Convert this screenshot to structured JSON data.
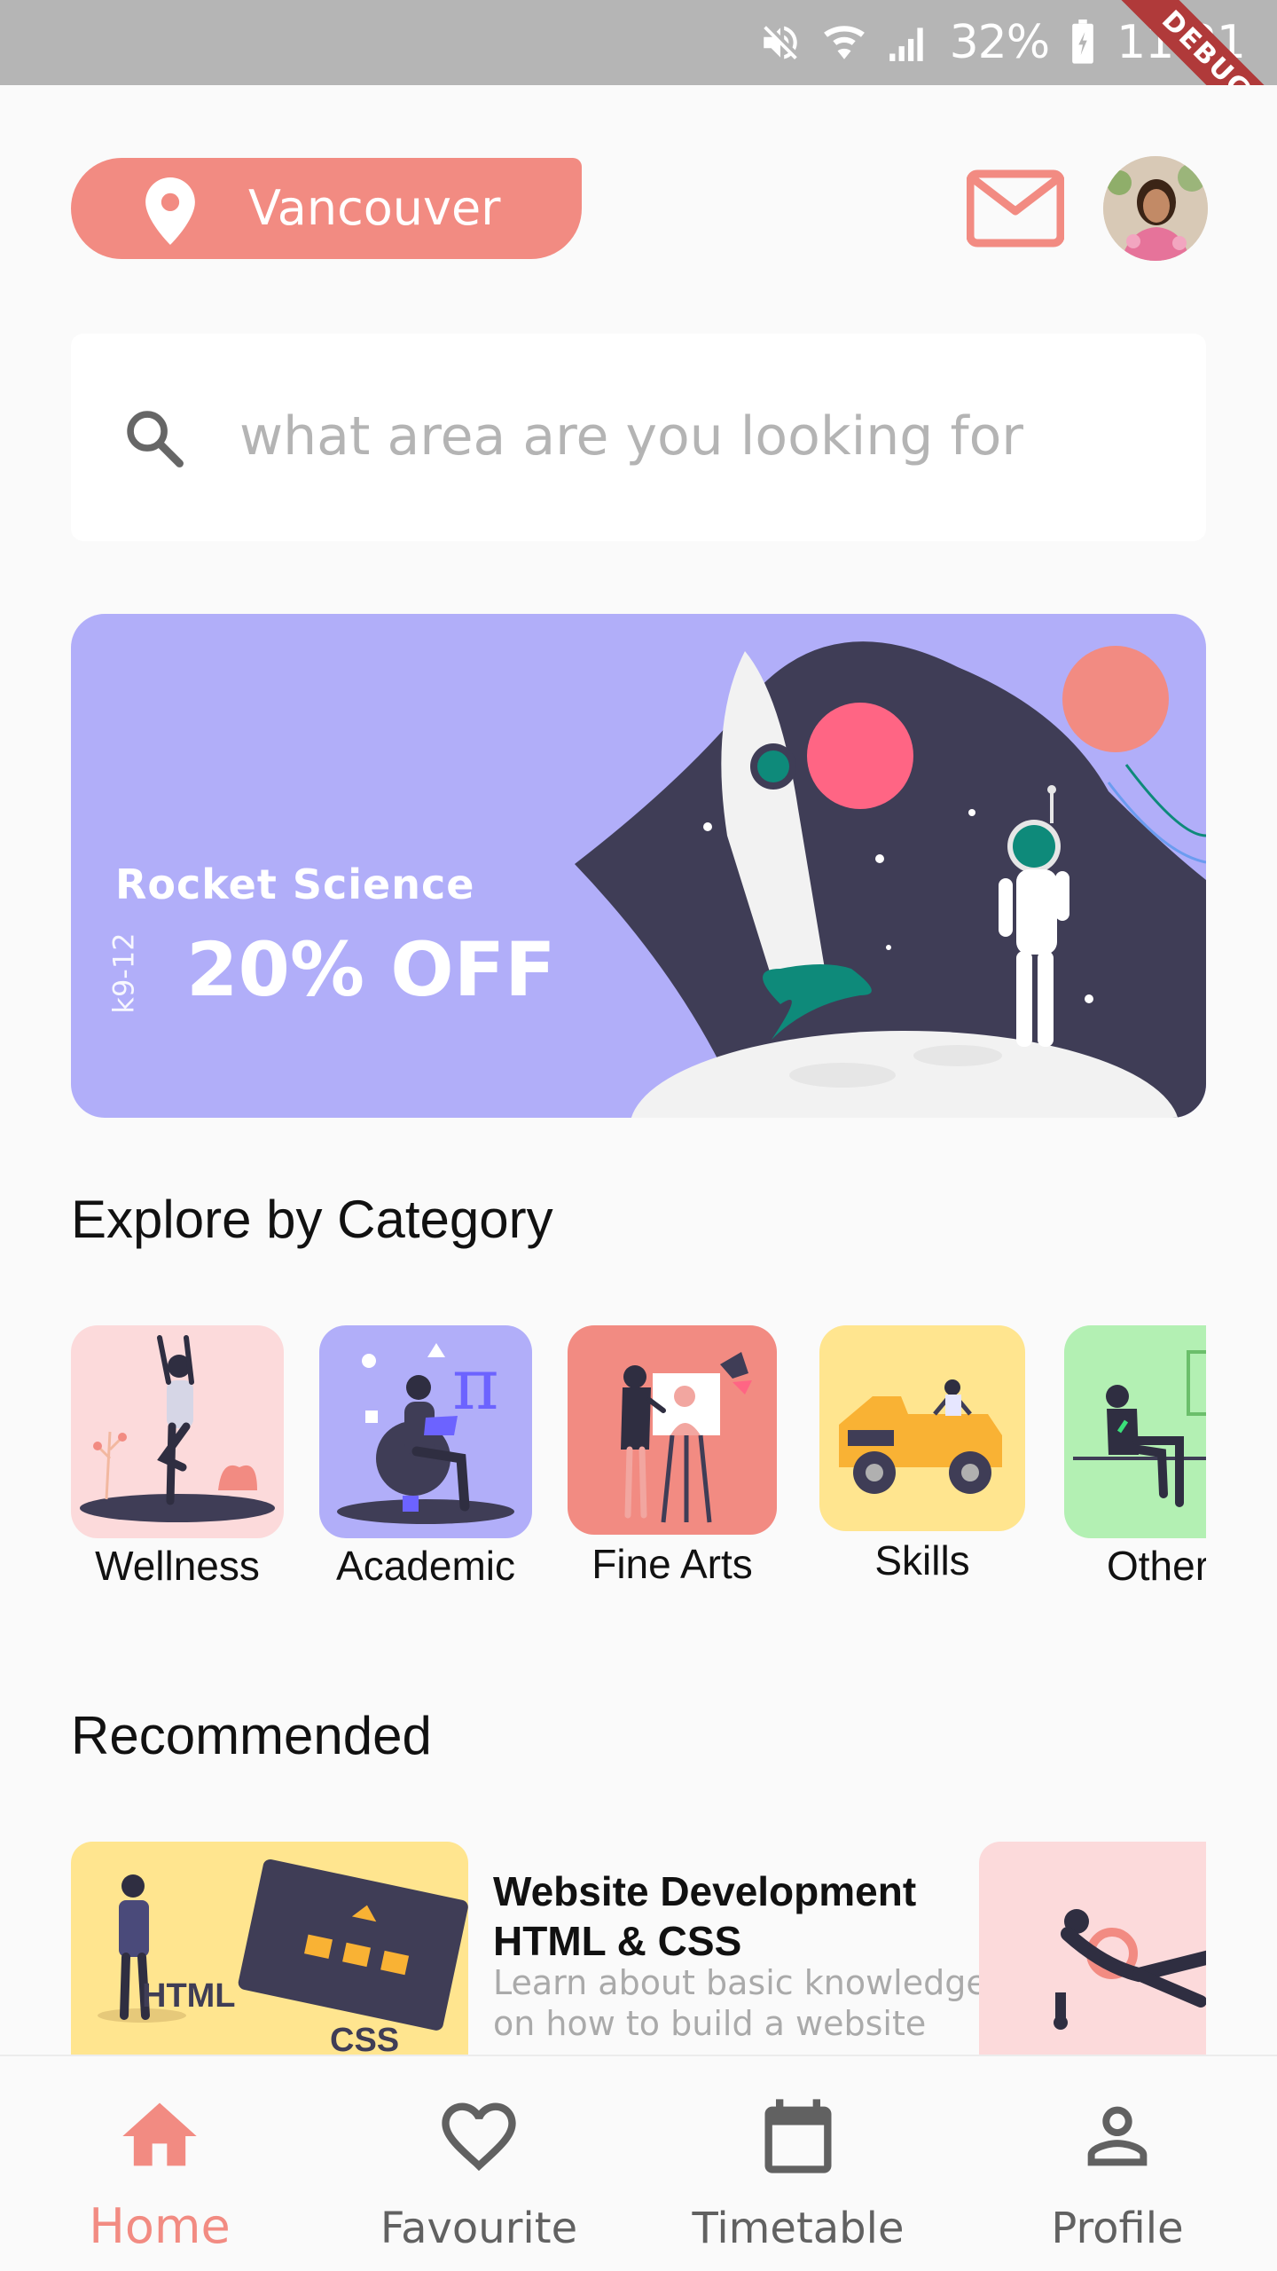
{
  "status_bar": {
    "battery_text": "32%",
    "time": "11:21",
    "debug_label": "DEBUG"
  },
  "header": {
    "location": "Vancouver",
    "mail_icon": "mail-icon",
    "avatar": "avatar"
  },
  "search": {
    "placeholder": "what area are you looking for"
  },
  "promo": {
    "subtitle": "Rocket Science",
    "discount": "20% OFF",
    "grade": "k9-12"
  },
  "sections": {
    "categories_title": "Explore by Category",
    "recommended_title": "Recommended"
  },
  "categories": [
    {
      "label": "Wellness",
      "color": "#fcdadb"
    },
    {
      "label": "Academic",
      "color": "#b1aef9"
    },
    {
      "label": "Fine Arts",
      "color": "#f28b82"
    },
    {
      "label": "Skills",
      "color": "#ffe58f"
    },
    {
      "label": "Other",
      "color": "#b3f0b3"
    }
  ],
  "recommended": [
    {
      "title": "Website Development HTML & CSS",
      "description": "Learn about basic knowledge on how to build a website",
      "image_text_1": "HTML",
      "image_text_2": "CSS"
    }
  ],
  "nav": [
    {
      "label": "Home",
      "icon": "home-icon",
      "active": true
    },
    {
      "label": "Favourite",
      "icon": "heart-icon",
      "active": false
    },
    {
      "label": "Timetable",
      "icon": "calendar-icon",
      "active": false
    },
    {
      "label": "Profile",
      "icon": "person-icon",
      "active": false
    }
  ],
  "colors": {
    "accent": "#f28b82",
    "promo_bg": "#b1aef9",
    "nav_inactive": "#616161"
  }
}
